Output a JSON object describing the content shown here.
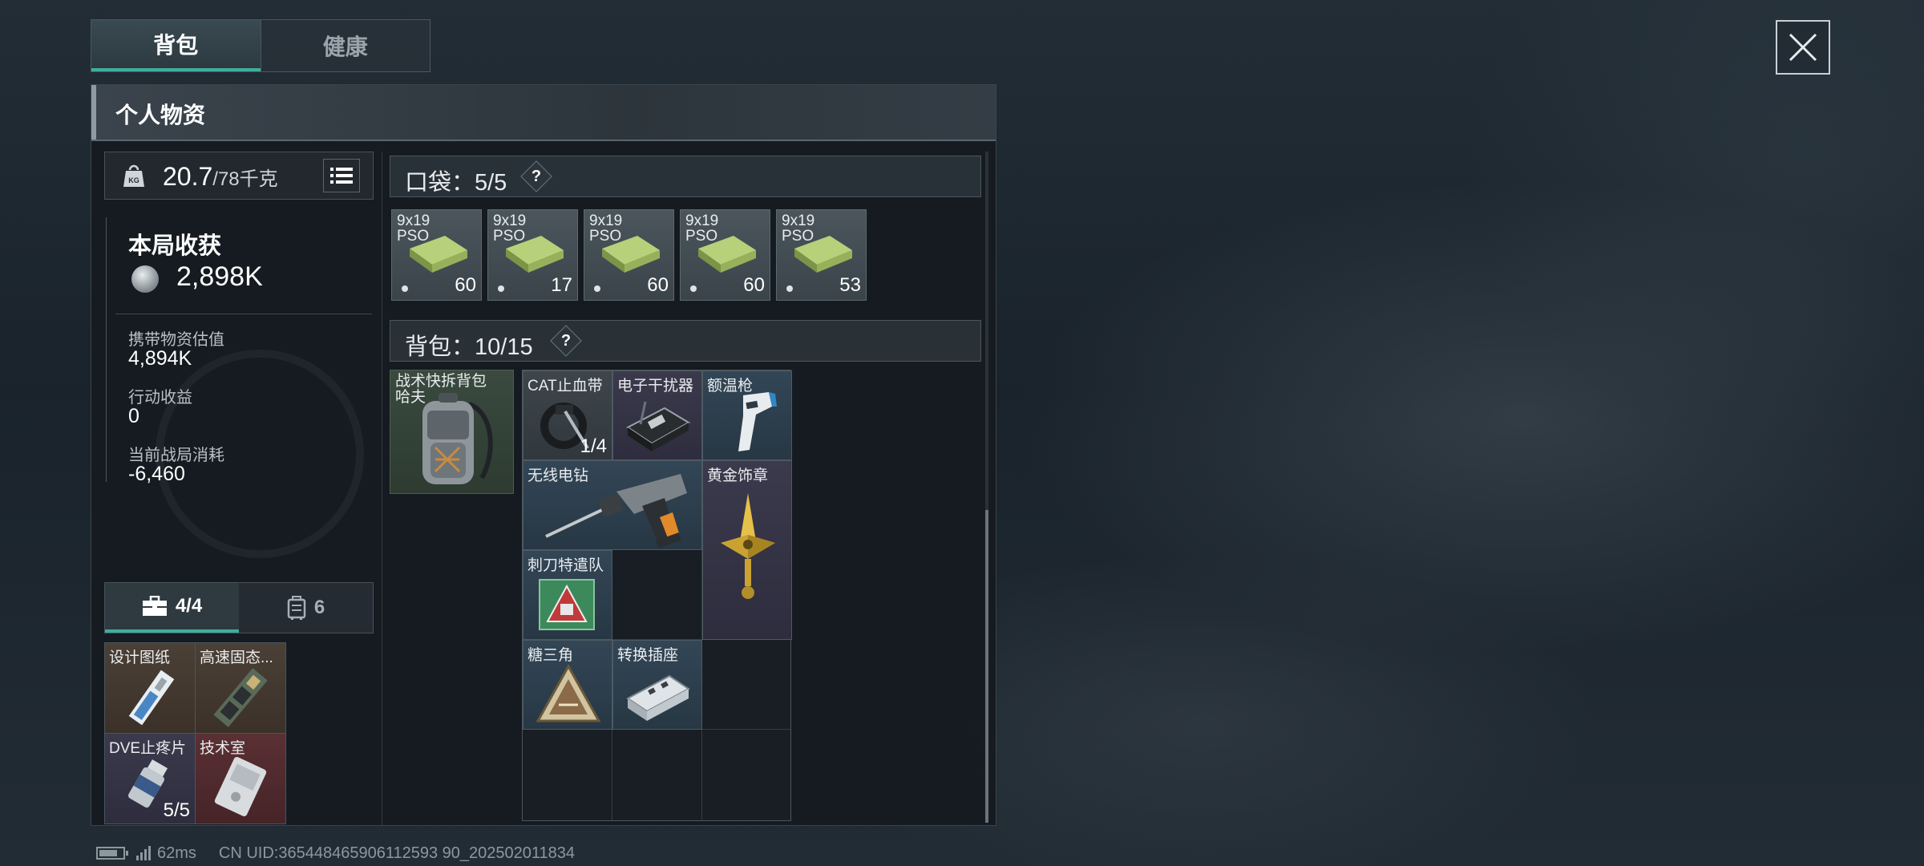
{
  "tabs": [
    "背包",
    "健康"
  ],
  "panel_title": "个人物资",
  "weight": {
    "current": "20.7",
    "max": "/78千克",
    "icon_label": "KG"
  },
  "harvest": {
    "title": "本局收获",
    "value": "2,898K",
    "stats": [
      {
        "label": "携带物资估值",
        "value": "4,894K"
      },
      {
        "label": "行动收益",
        "value": "0"
      },
      {
        "label": "当前战局消耗",
        "value": "-6,460"
      }
    ]
  },
  "secure_tabs": [
    {
      "icon": "toolbox-icon",
      "label": "4/4",
      "active": true
    },
    {
      "icon": "case-icon",
      "label": "6",
      "active": false
    }
  ],
  "secure_items": [
    {
      "name": "设计图纸",
      "icon": "blueprint-card-icon",
      "tint": "brown",
      "count": ""
    },
    {
      "name": "高速固态...",
      "icon": "ssd-icon",
      "tint": "brown",
      "count": ""
    },
    {
      "name": "DVE止疼片",
      "icon": "pill-bottle-icon",
      "tint": "purple",
      "count": "5/5"
    },
    {
      "name": "技术室",
      "icon": "keycard-icon",
      "tint": "red",
      "count": ""
    }
  ],
  "pocket": {
    "label": "口袋：5/5",
    "help": "?",
    "items": [
      {
        "name": "9x19\nPSO",
        "count": "60"
      },
      {
        "name": "9x19\nPSO",
        "count": "17"
      },
      {
        "name": "9x19\nPSO",
        "count": "60"
      },
      {
        "name": "9x19\nPSO",
        "count": "60"
      },
      {
        "name": "9x19\nPSO",
        "count": "53"
      }
    ]
  },
  "backpack": {
    "label": "背包：10/15",
    "help": "?",
    "equipped": {
      "name": "战术快拆背包\n哈夫",
      "icon": "backpack-icon"
    },
    "items": [
      {
        "name": "CAT止血带",
        "count": "1/4",
        "tint": "gray",
        "icon": "tourniquet-icon"
      },
      {
        "name": "电子干扰器",
        "count": "",
        "tint": "purple",
        "icon": "jammer-icon"
      },
      {
        "name": "额温枪",
        "count": "",
        "tint": "blue",
        "icon": "thermometer-gun-icon"
      },
      {
        "name": "无线电钻",
        "count": "",
        "tint": "blue",
        "icon": "drill-icon"
      },
      {
        "name": "黄金饰章",
        "count": "",
        "tint": "purple",
        "icon": "gold-badge-icon"
      },
      {
        "name": "刺刀特遣队",
        "count": "",
        "tint": "blue",
        "icon": "patch-icon"
      },
      {
        "name": "糖三角",
        "count": "",
        "tint": "blue",
        "icon": "triangle-icon"
      },
      {
        "name": "转换插座",
        "count": "",
        "tint": "blue",
        "icon": "power-strip-icon"
      }
    ]
  },
  "status": {
    "ping": "62ms",
    "uid": "CN UID:365448465906112593 90_202502011834"
  },
  "colors": {
    "accent": "#3fae9c",
    "panel": "#151b20"
  }
}
